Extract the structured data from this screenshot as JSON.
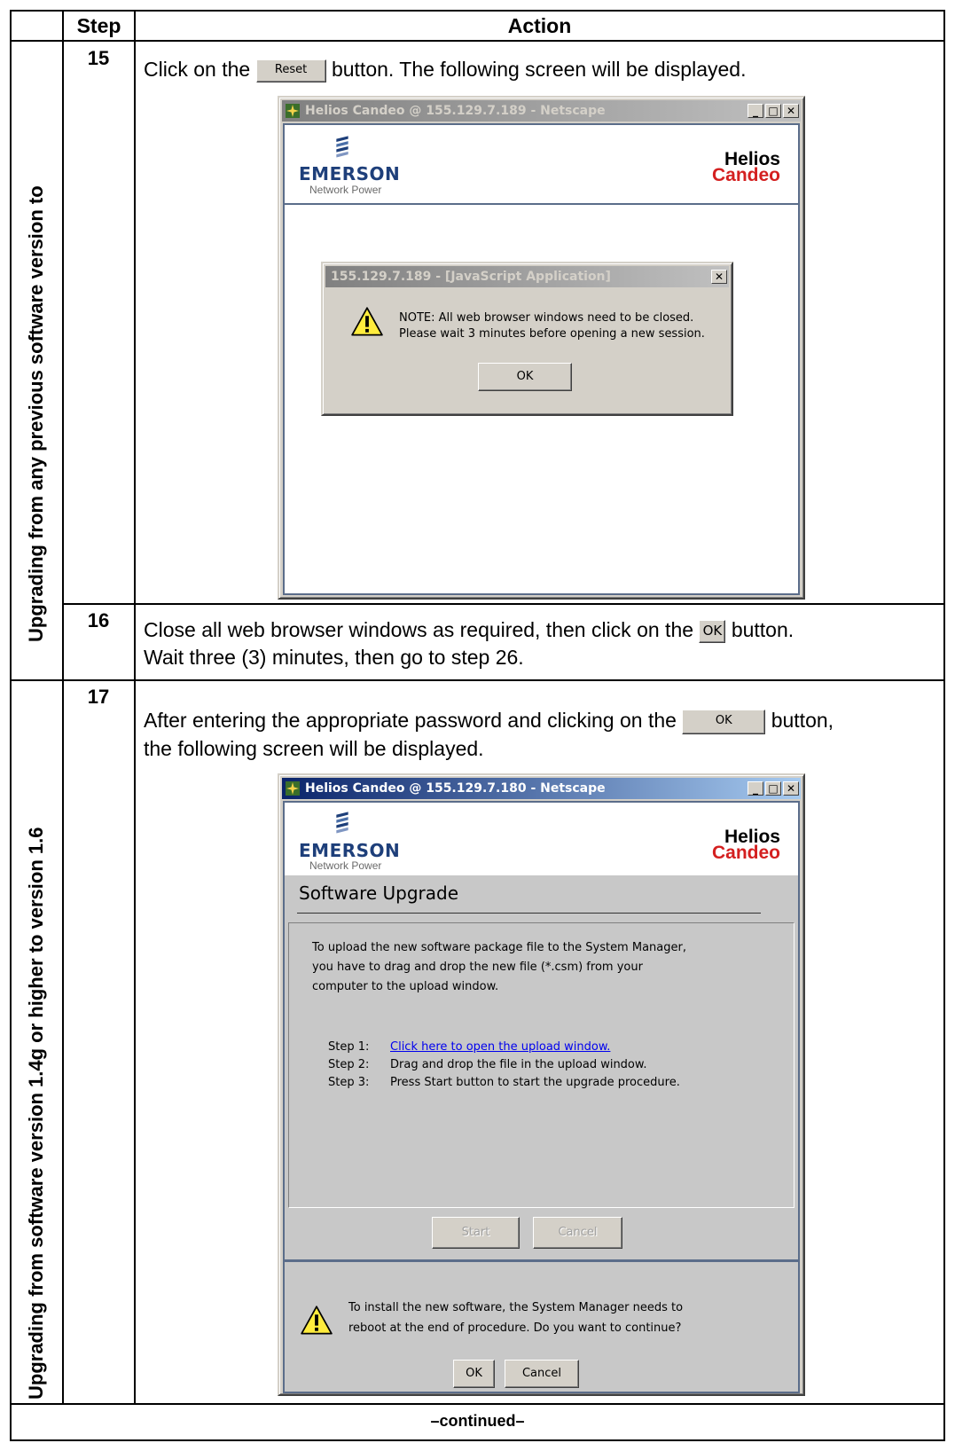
{
  "header": {
    "step": "Step",
    "action": "Action"
  },
  "sections": [
    {
      "label": "Upgrading from any previous software version to"
    },
    {
      "label": "Upgrading from software version 1.4g or higher to version 1.6"
    }
  ],
  "steps": {
    "s15": {
      "number": "15",
      "text_before": "Click on the",
      "button": "Reset",
      "text_after": "button. The following screen will be displayed."
    },
    "s16": {
      "number": "16",
      "line1_before": "Close all web browser windows as required, then click on the",
      "button": "OK",
      "line1_after": "button.",
      "line2": "Wait three (3) minutes, then go to step 26."
    },
    "s17": {
      "number": "17",
      "line1_before": "After entering the appropriate password and clicking on the",
      "button": "OK",
      "line1_after": "button,",
      "line2": "the following screen will be displayed."
    }
  },
  "screen1": {
    "window_title": "Helios Candeo @ 155.129.7.189 - Netscape",
    "brand": {
      "emerson": "EMERSON",
      "network_power": "Network Power",
      "helios": "Helios",
      "candeo": "Candeo"
    },
    "dialog": {
      "title": "155.129.7.189 - [JavaScript Application]",
      "message_line1": "NOTE: All web browser windows need to be closed.",
      "message_line2": "Please wait 3 minutes before opening a new session.",
      "ok": "OK"
    }
  },
  "screen2": {
    "window_title": "Helios Candeo @ 155.129.7.180 - Netscape",
    "brand": {
      "emerson": "EMERSON",
      "network_power": "Network Power",
      "helios": "Helios",
      "candeo": "Candeo"
    },
    "heading": "Software Upgrade",
    "intro_line1": "To upload the new software package file to the System Manager,",
    "intro_line2": "you have to drag and drop the new file (*.csm) from your",
    "intro_line3": "computer to the upload window.",
    "step1_label": "Step 1:",
    "step1_link": "Click here to open the upload window.",
    "step2_label": "Step 2:",
    "step2_text": "Drag and drop the file in the upload window.",
    "step3_label": "Step 3:",
    "step3_text": "Press Start button to start the upgrade procedure.",
    "start": "Start",
    "cancel": "Cancel",
    "confirm_line1": "To install the new software, the System Manager needs to",
    "confirm_line2": "reboot at the end of procedure. Do you want to continue?",
    "confirm_ok": "OK",
    "confirm_cancel": "Cancel"
  },
  "footer": {
    "continued": "–continued–"
  },
  "icons": [
    "windows-close-icon",
    "minimize-icon",
    "maximize-icon",
    "warning-icon",
    "emerson-logo-icon",
    "netscape-icon"
  ],
  "colors": {
    "titlebar_active": "#0a246a",
    "titlebar_inactive": "#808080",
    "candeo_red": "#d42020",
    "emerson_blue": "#1e3f7a",
    "link": "#0000ee"
  }
}
